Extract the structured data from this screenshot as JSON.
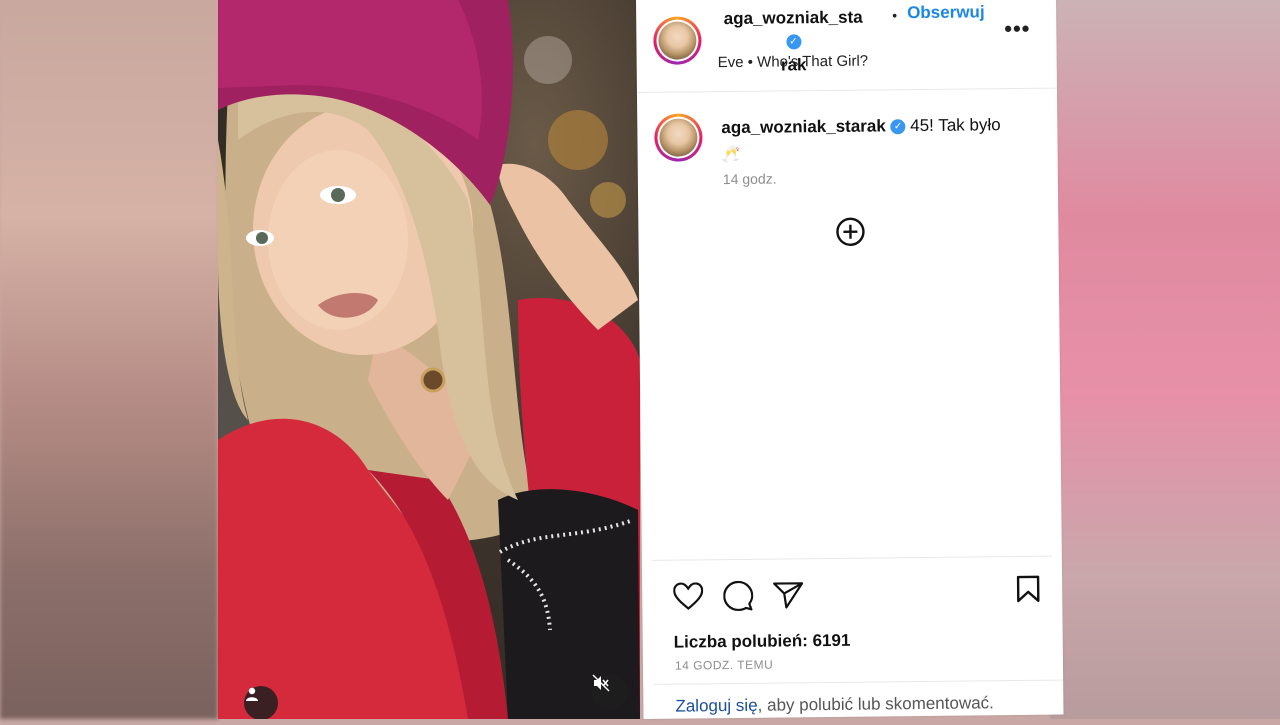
{
  "post": {
    "header": {
      "username_line1": "aga_wozniak_sta",
      "username_line2": "rak",
      "verified_symbol": "✓",
      "separator": "•",
      "follow_label": "Obserwuj",
      "audio_artist": "Eve",
      "audio_separator": "•",
      "audio_track": "Who's That Girl?",
      "more_icon": "more-horizontal-icon"
    },
    "caption": {
      "username": "aga_wozniak_starak",
      "verified_symbol": "✓",
      "text": "45! Tak było",
      "emoji": "🥂",
      "time": "14 godz."
    },
    "load_more_icon": "plus-circle-icon",
    "actions": {
      "like_icon": "heart-icon",
      "comment_icon": "comment-icon",
      "share_icon": "send-icon",
      "save_icon": "bookmark-icon"
    },
    "likes_text": "Liczba polubień: 6191",
    "time_ago": "14 GODZ. TEMU",
    "login_prompt": {
      "link": "Zaloguj się",
      "rest": ", aby polubić lub skomentować."
    }
  },
  "media": {
    "tagged_user_icon": "user-icon",
    "mute_icon": "volume-muted-icon"
  },
  "colors": {
    "accent_blue": "#1a87e6",
    "verified_blue": "#3897f0",
    "hat": "#a0215f",
    "jacket": "#d42a3c"
  }
}
